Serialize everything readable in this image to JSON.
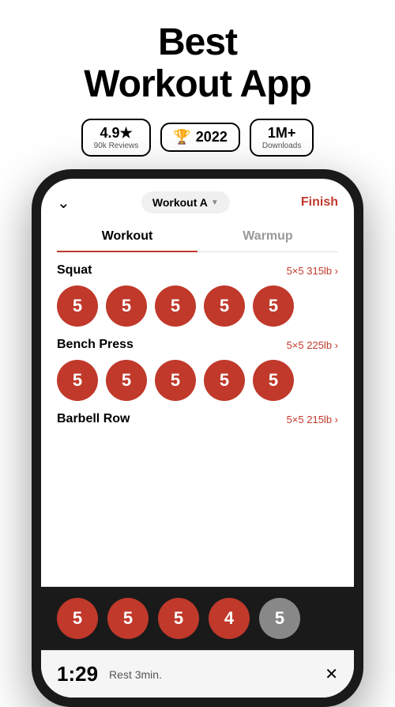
{
  "header": {
    "title_line1": "Best",
    "title_line2": "Workout App"
  },
  "badges": [
    {
      "id": "rating",
      "main": "4.9★",
      "sub": "90k Reviews"
    },
    {
      "id": "award",
      "icon": "🏆",
      "year": "2022"
    },
    {
      "id": "downloads",
      "main": "1M+",
      "sub": "Downloads"
    }
  ],
  "app": {
    "workout_name": "Workout A",
    "finish_label": "Finish",
    "tabs": [
      {
        "id": "workout",
        "label": "Workout",
        "active": true
      },
      {
        "id": "warmup",
        "label": "Warmup",
        "active": false
      }
    ],
    "exercises": [
      {
        "name": "Squat",
        "meta": "5×5 315lb ›",
        "sets": [
          5,
          5,
          5,
          5,
          5
        ]
      },
      {
        "name": "Bench Press",
        "meta": "5×5 225lb ›",
        "sets": [
          5,
          5,
          5,
          5,
          5
        ]
      },
      {
        "name": "Barbell Row",
        "meta": "5×5 215lb ›",
        "sets": [
          5,
          5,
          5,
          4,
          5
        ]
      }
    ],
    "bottom_sets": [
      5,
      5,
      5,
      4,
      5
    ],
    "bottom_set_states": [
      "red",
      "red",
      "red",
      "red",
      "grey"
    ],
    "rest_timer": {
      "time": "1:29",
      "label": "Rest 3min."
    }
  }
}
